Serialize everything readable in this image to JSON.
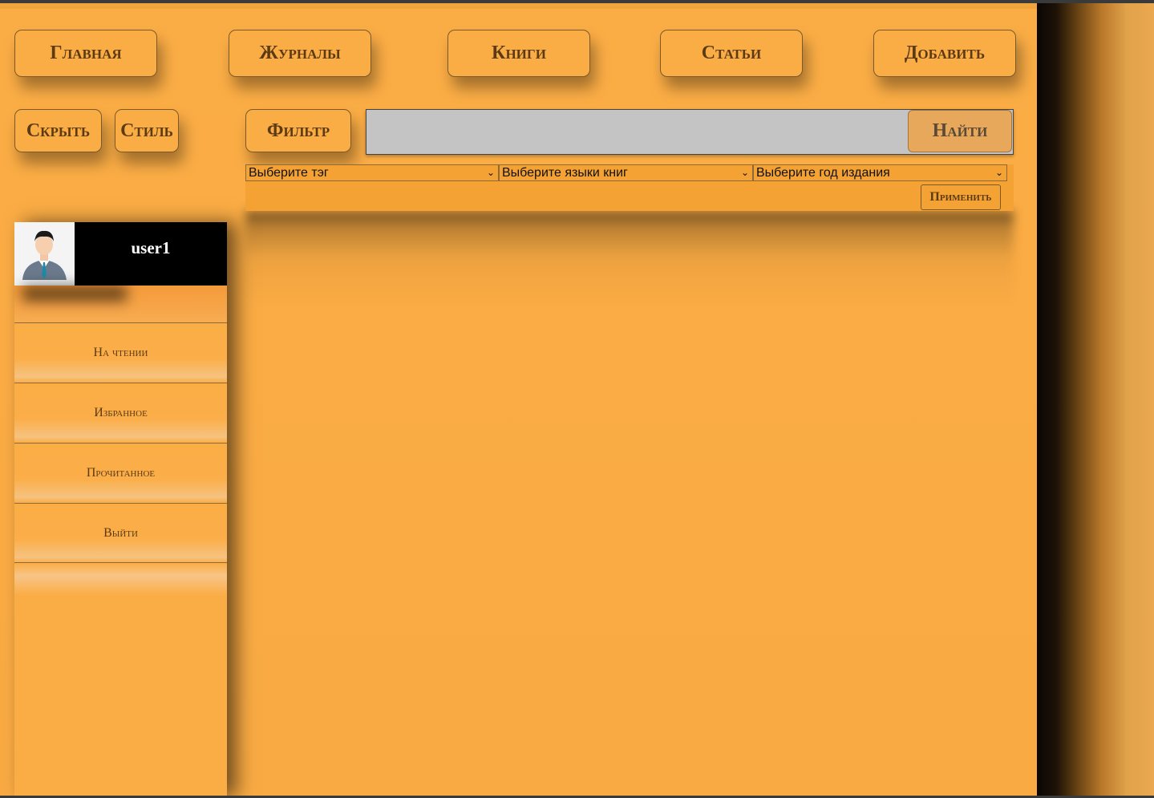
{
  "nav": {
    "home": "Главная",
    "journals": "Журналы",
    "books": "Книги",
    "articles": "Статьи",
    "add": "Добавить"
  },
  "toolbar": {
    "hide": "Скрыть",
    "style": "Стиль",
    "filter": "Фильтр"
  },
  "search": {
    "value": "",
    "button": "Найти"
  },
  "filters": {
    "tag": "Выберите тэг",
    "language": "Выберите языки книг",
    "year": "Выберите год издания",
    "apply": "Применить"
  },
  "user": {
    "name": "user1"
  },
  "sidebar": {
    "items": [
      {
        "label": "На чтении"
      },
      {
        "label": "Избранное"
      },
      {
        "label": "Прочитанное"
      },
      {
        "label": "Выйти"
      }
    ]
  },
  "colors": {
    "background": "#fbad45",
    "search_bg": "#c4c4c4",
    "user_card": "#000000"
  }
}
